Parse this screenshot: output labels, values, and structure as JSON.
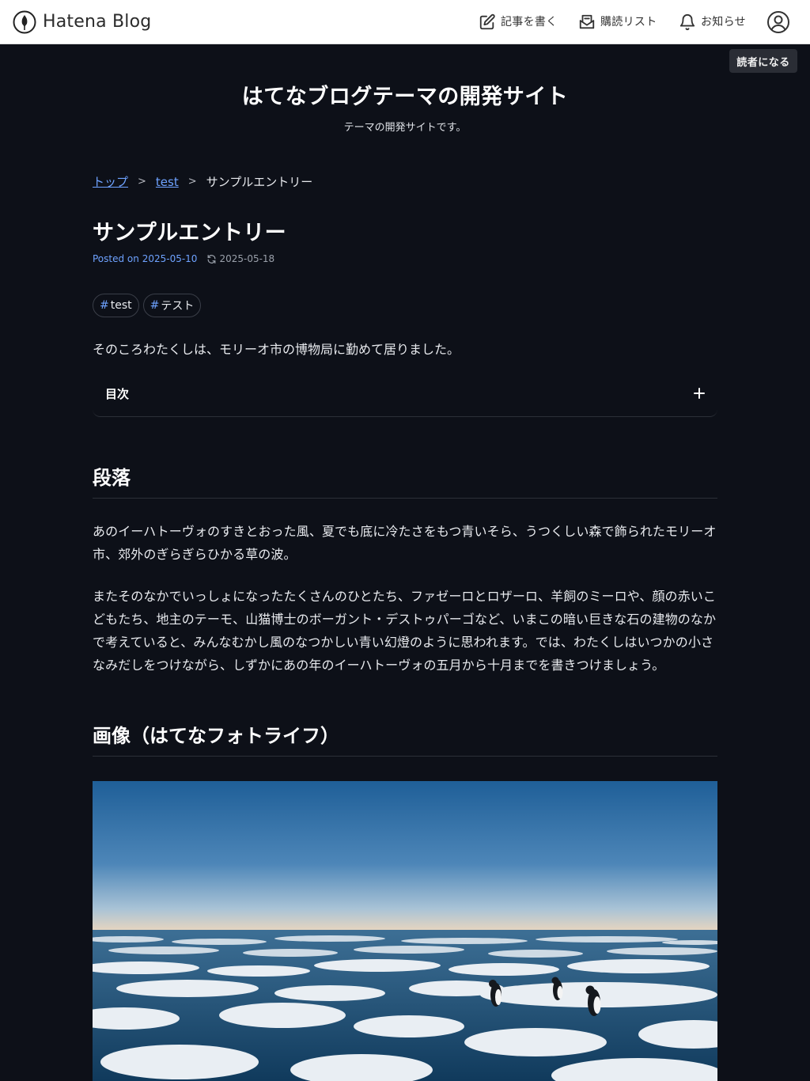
{
  "global_header": {
    "brand": "Hatena Blog",
    "write_label": "記事を書く",
    "reading_list_label": "購読リスト",
    "notifications_label": "お知らせ"
  },
  "subscribe_label": "読者になる",
  "blog": {
    "title": "はてなブログテーマの開発サイト",
    "description": "テーマの開発サイトです。"
  },
  "breadcrumb": {
    "items": [
      "トップ",
      "test"
    ],
    "current": "サンプルエントリー",
    "separator": ">"
  },
  "entry": {
    "title": "サンプルエントリー",
    "posted_label": "Posted on",
    "posted_date": "2025-05-10",
    "updated_date": "2025-05-18",
    "tags": [
      {
        "hash": "#",
        "label": "test"
      },
      {
        "hash": "#",
        "label": "テスト"
      }
    ],
    "lead": "そのころわたくしは、モリーオ市の博物局に勤めて居りました。",
    "toc_label": "目次",
    "section1_heading": "段落",
    "paragraph1": "あのイーハトーヴォのすきとおった風、夏でも底に冷たさをもつ青いそら、うつくしい森で飾られたモリーオ市、郊外のぎらぎらひかる草の波。",
    "paragraph2": "またそのなかでいっしょになったたくさんのひとたち、ファゼーロとロザーロ、羊飼のミーロや、顔の赤いこどもたち、地主のテーモ、山猫博士のボーガント・デストゥパーゴなど、いまこの暗い巨きな石の建物のなかで考えていると、みんなむかし風のなつかしい青い幻燈のように思われます。では、わたくしはいつかの小さなみだしをつけながら、しずかにあの年のイーハトーヴォの五月から十月までを書きつけましょう。",
    "section2_heading": "画像（はてなフォトライフ）"
  },
  "colors": {
    "background": "#0d1018",
    "link": "#6ea2ff",
    "header_bg": "#ffffff"
  }
}
